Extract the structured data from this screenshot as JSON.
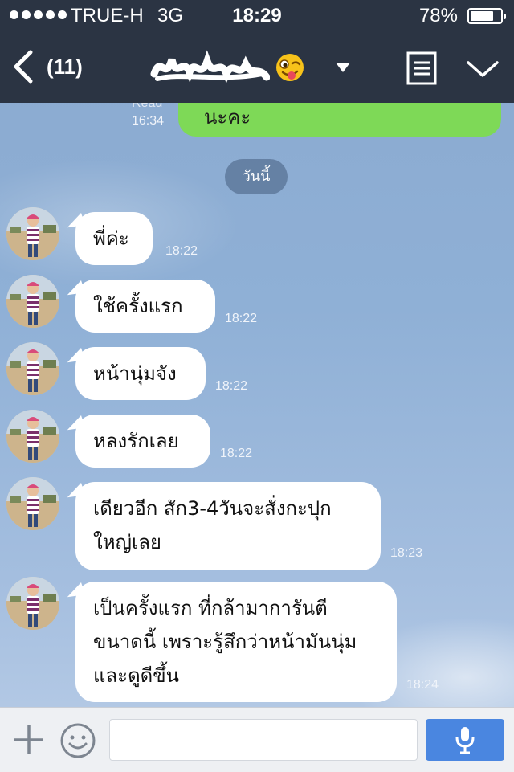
{
  "status_bar": {
    "carrier": "TRUE-H",
    "network": "3G",
    "time": "18:29",
    "battery_percent": "78%",
    "battery_level": 0.78,
    "signal_bars": 5
  },
  "header": {
    "unread_count": "(11)",
    "title_emoji": "winking-tongue-emoji",
    "icons": [
      "back-chevron-icon",
      "dropdown-triangle-icon",
      "notes-menu-icon",
      "collapse-chevron-icon"
    ]
  },
  "chat": {
    "sent_partial": {
      "read_label": "Read",
      "time": "16:34",
      "text": "นะคะ"
    },
    "date_divider": "วันนี้",
    "messages": [
      {
        "text": "พี่ค่ะ",
        "time": "18:22"
      },
      {
        "text": "ใช้ครั้งแรก",
        "time": "18:22"
      },
      {
        "text": "หน้านุ่มจัง",
        "time": "18:22"
      },
      {
        "text": "หลงรักเลย",
        "time": "18:22"
      },
      {
        "lines": [
          "เดียวอีก สัก3-4วันจะสั่งกะปุก",
          "ใหญ่เลย"
        ],
        "time": "18:23"
      },
      {
        "lines": [
          "เป็นครั้งแรก ที่กล้ามาการันตี",
          "ขนาดนี้ เพราะรู้สึกว่าหน้ามันนุ่ม",
          "และดูดีขึ้น"
        ],
        "time": "18:24"
      }
    ]
  },
  "input_bar": {
    "value": "",
    "icons": [
      "plus-icon",
      "emoji-icon",
      "microphone-icon"
    ]
  },
  "colors": {
    "header_bg": "#2b3443",
    "sent_bubble": "#7ed957",
    "received_bubble": "#ffffff",
    "mic_button": "#4a86e0"
  }
}
